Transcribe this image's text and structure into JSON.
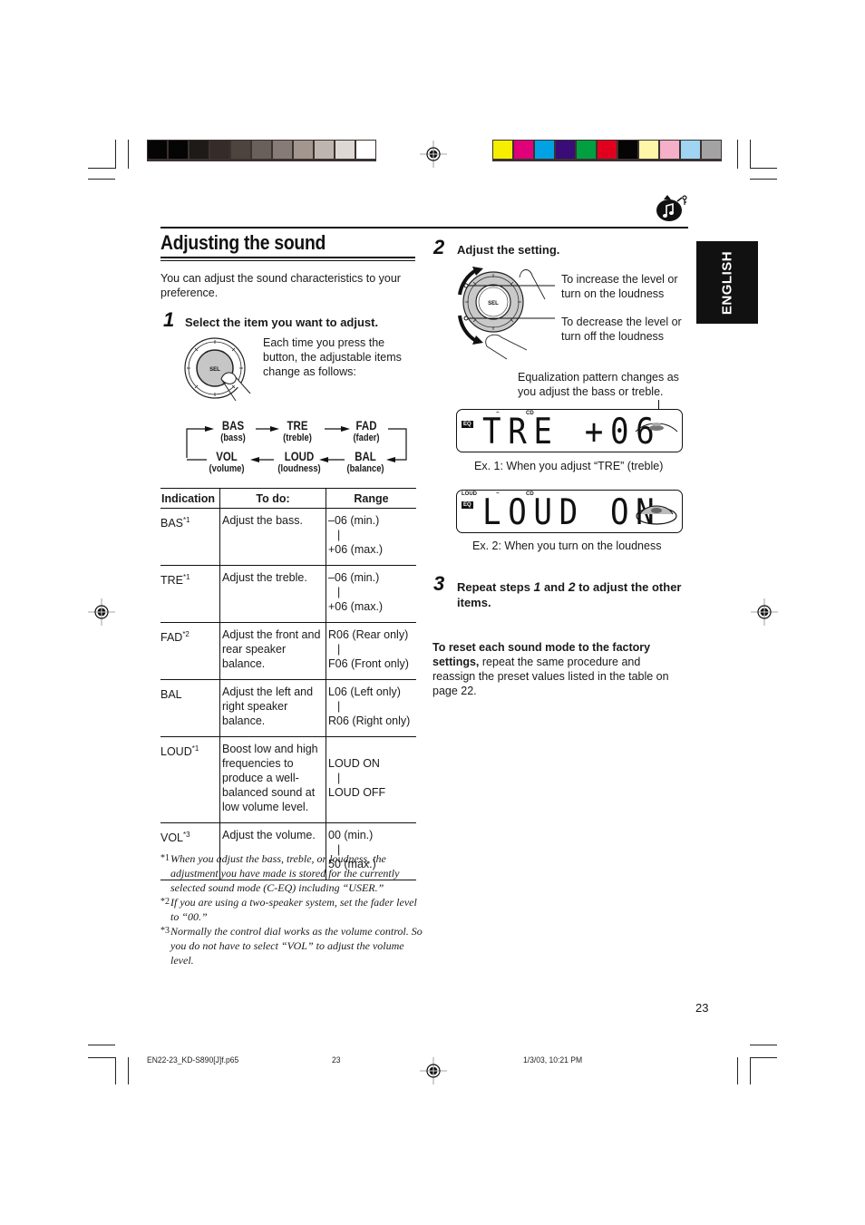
{
  "print_marks": {
    "grayscale_swatches": [
      "#050505",
      "#050505",
      "#1e1a18",
      "#352c29",
      "#4d4440",
      "#6a605b",
      "#867b76",
      "#a2968f",
      "#bfb5af",
      "#ddd8d3",
      "#ffffff"
    ],
    "color_swatches": [
      "#f5ee00",
      "#e0007a",
      "#00a2e3",
      "#3a0c78",
      "#00a040",
      "#e0001e",
      "#050505",
      "#fff6a8",
      "#f5afc8",
      "#9fd4f2",
      "#a3a3a3"
    ]
  },
  "header": {
    "icon": "music-note-bag-icon",
    "title": "Adjusting the sound",
    "language_tab": "ENGLISH"
  },
  "intro": "You can adjust the sound characteristics to your preference.",
  "step1": {
    "number": "1",
    "heading": "Select the item you want to adjust.",
    "dial_label": "SEL",
    "description": "Each time you press the button, the adjustable items change as follows:",
    "cycle": [
      {
        "key": "BAS",
        "sub": "(bass)"
      },
      {
        "key": "TRE",
        "sub": "(treble)"
      },
      {
        "key": "FAD",
        "sub": "(fader)"
      },
      {
        "key": "BAL",
        "sub": "(balance)"
      },
      {
        "key": "LOUD",
        "sub": "(loudness)"
      },
      {
        "key": "VOL",
        "sub": "(volume)"
      }
    ]
  },
  "table": {
    "headers": [
      "Indication",
      "To do:",
      "Range"
    ],
    "rows": [
      {
        "indication": "BAS",
        "note": "*1",
        "todo": "Adjust the bass.",
        "range_from": "–06 (min.)",
        "range_to": "+06 (max.)"
      },
      {
        "indication": "TRE",
        "note": "*1",
        "todo": "Adjust the treble.",
        "range_from": "–06 (min.)",
        "range_to": "+06 (max.)"
      },
      {
        "indication": "FAD",
        "note": "*2",
        "todo": "Adjust the front and rear speaker balance.",
        "range_from": "R06 (Rear only)",
        "range_to": "F06 (Front only)"
      },
      {
        "indication": "BAL",
        "note": "",
        "todo": "Adjust the left and right speaker balance.",
        "range_from": "L06 (Left only)",
        "range_to": "R06 (Right only)"
      },
      {
        "indication": "LOUD",
        "note": "*1",
        "todo": "Boost low and high frequencies to produce a well-balanced sound at low volume level.",
        "range_from": "LOUD ON",
        "range_to": "LOUD OFF"
      },
      {
        "indication": "VOL",
        "note": "*3",
        "todo": "Adjust the volume.",
        "range_from": "00 (min.)",
        "range_to": "50 (max.)"
      }
    ],
    "range_separator": "|"
  },
  "footnotes": [
    {
      "mark": "*1",
      "text": "When you adjust the bass, treble, or loudness, the adjustment you have made is stored for the currently selected sound mode (C-EQ) including “USER.”"
    },
    {
      "mark": "*2",
      "text": "If you are using a two-speaker system, set the fader level to “00.”"
    },
    {
      "mark": "*3",
      "text": "Normally the control dial works as the volume control. So you do not have to select “VOL” to adjust the volume level."
    }
  ],
  "step2": {
    "number": "2",
    "heading": "Adjust the setting.",
    "dial_label": "SEL",
    "increase_text": "To increase the level or turn on the loudness",
    "decrease_text": "To decrease the level or turn off the loudness",
    "eq_callout": "Equalization pattern changes as you adjust the bass or treble.",
    "display1": {
      "eq_badge": "EQ",
      "cd_label": "CD",
      "text": "TRE +06",
      "caption": "Ex. 1: When you adjust “TRE” (treble)"
    },
    "display2": {
      "loud_label": "LOUD",
      "eq_badge": "EQ",
      "cd_label": "CD",
      "text": "LOUD ON",
      "caption": "Ex. 2: When you turn on the loudness"
    }
  },
  "step3": {
    "number": "3",
    "heading_pre": "Repeat steps ",
    "ref1": "1",
    "heading_mid": " and ",
    "ref2": "2",
    "heading_post": " to adjust the other items."
  },
  "reset": {
    "bold": "To reset each sound mode to the factory settings,",
    "text": " repeat the same procedure and reassign the preset values listed in the table on page 22."
  },
  "page_number": "23",
  "footer": {
    "filename": "EN22-23_KD-S890[J]f.p65",
    "page": "23",
    "timestamp": "1/3/03, 10:21 PM"
  }
}
